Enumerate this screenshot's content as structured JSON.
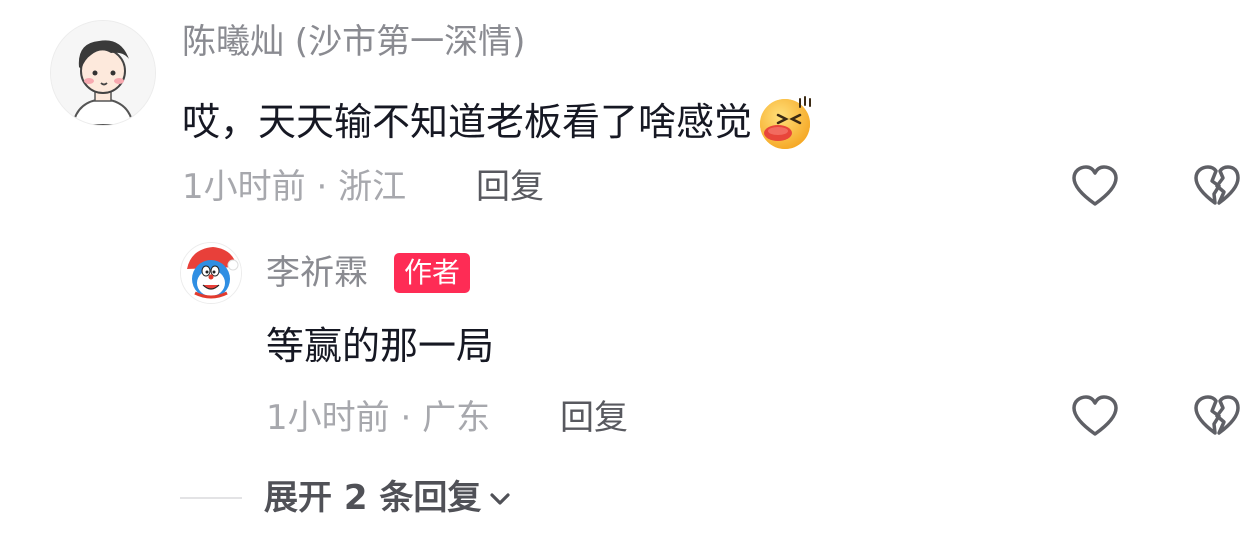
{
  "comments": [
    {
      "username": "陈曦灿 (沙市第一深情)",
      "content": "哎，天天输不知道老板看了啥感觉",
      "emoji": "blushing-kiss-emoji",
      "time": "1小时前",
      "location": "浙江",
      "reply_label": "回复"
    }
  ],
  "replies": [
    {
      "username": "李祈霖",
      "badge": "作者",
      "content": "等赢的那一局",
      "time": "1小时前",
      "location": "广东",
      "reply_label": "回复"
    }
  ],
  "expand_replies": {
    "label": "展开 2 条回复"
  },
  "colors": {
    "badge": "#fe2c55",
    "username": "#8a8b91",
    "meta": "#a7a8ad",
    "text": "#161823"
  },
  "icons": {
    "like": "heart-outline-icon",
    "dislike": "broken-heart-icon",
    "expand": "chevron-down-icon"
  }
}
